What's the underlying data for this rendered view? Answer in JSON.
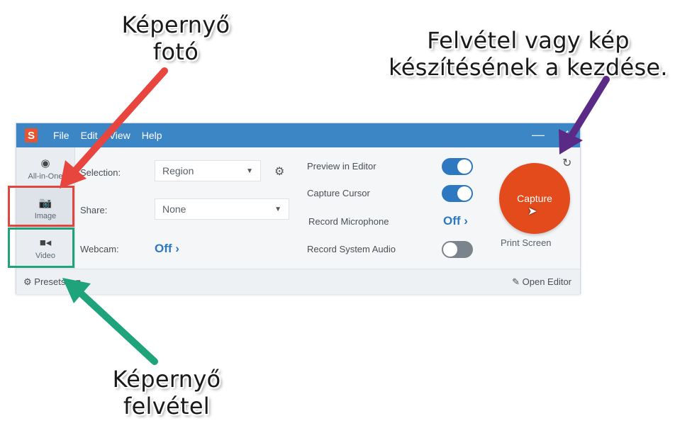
{
  "callouts": {
    "photo": [
      "Képernyő",
      "fotó"
    ],
    "capture": [
      "Felvétel vagy kép",
      "készítésének a kezdése."
    ],
    "video": [
      "Képernyő",
      "felvétel"
    ]
  },
  "window": {
    "menu": [
      "File",
      "Edit",
      "View",
      "Help"
    ],
    "minimize": "—",
    "close": "✕"
  },
  "modes": [
    {
      "label": "All-in-One",
      "icon": "record-icon"
    },
    {
      "label": "Image",
      "icon": "camera-icon"
    },
    {
      "label": "Video",
      "icon": "video-camera-icon"
    }
  ],
  "settings": {
    "selection_label": "Selection:",
    "selection_value": "Region",
    "share_label": "Share:",
    "share_value": "None",
    "webcam_label": "Webcam:",
    "webcam_value": "Off ›"
  },
  "options": {
    "preview_label": "Preview in Editor",
    "preview_state": "on",
    "cursor_label": "Capture Cursor",
    "cursor_state": "on",
    "mic_label": "Record Microphone",
    "mic_value": "Off ›",
    "audio_label": "Record System Audio",
    "audio_state": "off"
  },
  "capture": {
    "button_label": "Capture",
    "hotkey": "Print Screen"
  },
  "footer": {
    "presets": "Presets",
    "open_editor": "Open Editor"
  },
  "colors": {
    "titlebar": "#3d86c6",
    "capture": "#e34a1c",
    "toggle_on": "#2e78c2",
    "arrow_red": "#e8453e",
    "arrow_purple": "#5b2a86",
    "arrow_green": "#1ea37a"
  }
}
